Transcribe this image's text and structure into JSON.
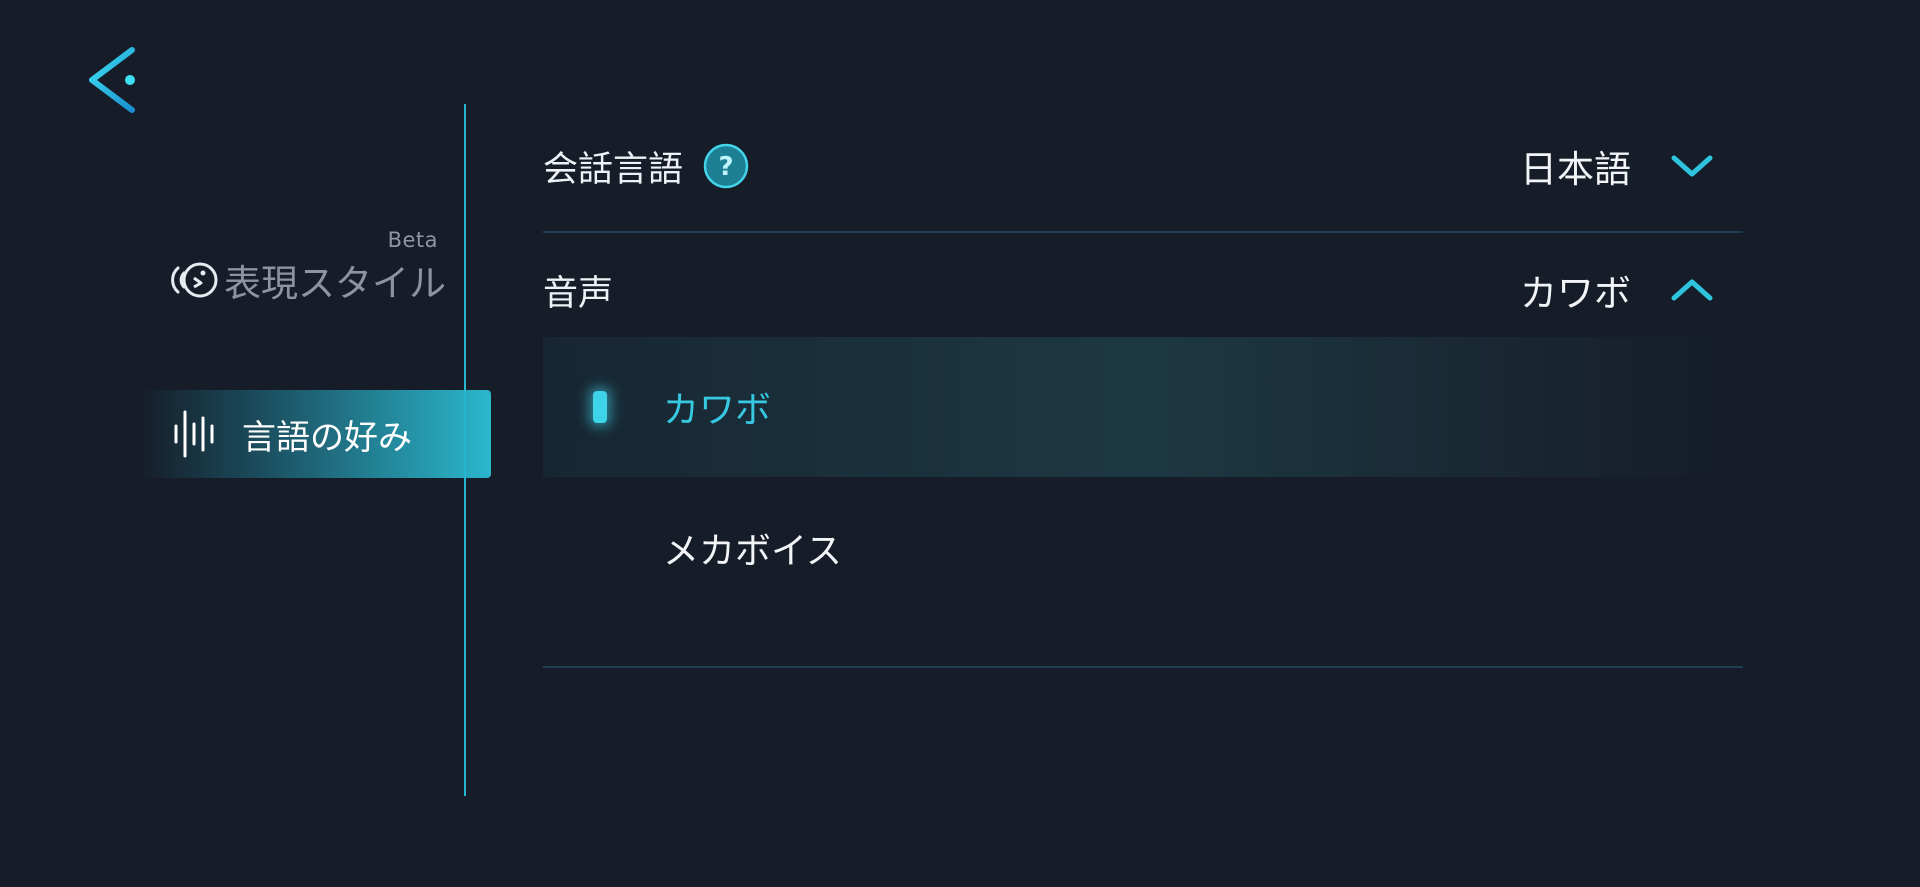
{
  "navigation": {
    "back_icon": "back-arrow-icon"
  },
  "sidebar": {
    "items": [
      {
        "label": "表現スタイル",
        "badge": "Beta",
        "icon": "expression-style-icon",
        "state": "inactive"
      },
      {
        "label": "言語の好み",
        "icon": "sound-wave-icon",
        "state": "active"
      }
    ]
  },
  "settings": {
    "conversation_language": {
      "label": "会話言語",
      "help_icon": "help-icon",
      "value": "日本語",
      "chevron": "chevron-down-icon"
    },
    "voice": {
      "label": "音声",
      "value": "カワボ",
      "chevron": "chevron-up-icon",
      "expanded": true,
      "options": [
        {
          "label": "カワボ",
          "selected": true
        },
        {
          "label": "メカボイス",
          "selected": false
        }
      ]
    }
  },
  "colors": {
    "background": "#161c28",
    "accent": "#2bb7cd",
    "accent_text": "#36c9e1",
    "separator": "#223a52",
    "dim_text": "#8c94a1"
  }
}
